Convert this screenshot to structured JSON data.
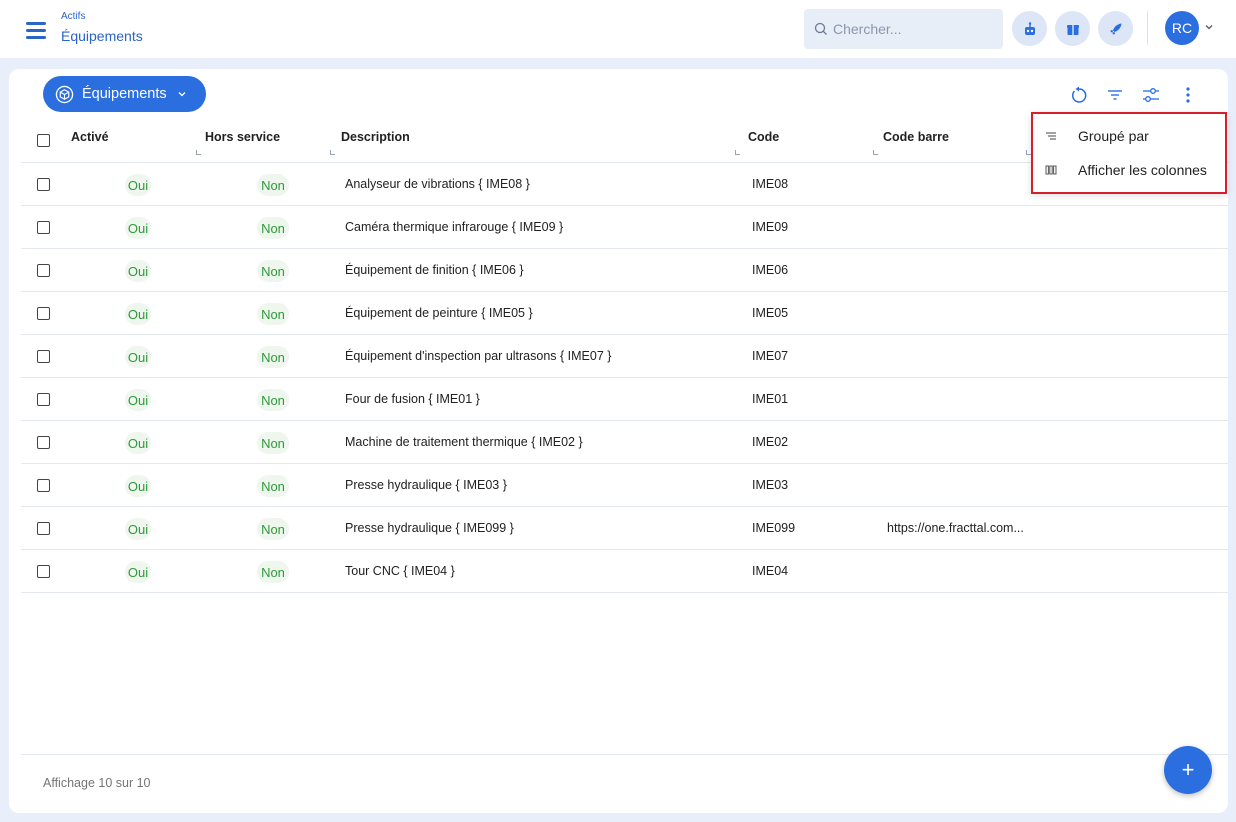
{
  "header": {
    "breadcrumb_parent": "Actifs",
    "title": "Équipements",
    "search_placeholder": "Chercher...",
    "avatar_initials": "RC"
  },
  "toolbar": {
    "view_selector_label": "Équipements"
  },
  "menu": {
    "items": [
      {
        "label": "Groupé par",
        "icon": "group-by-icon"
      },
      {
        "label": "Afficher les colonnes",
        "icon": "columns-icon"
      }
    ]
  },
  "table": {
    "columns": [
      "Activé",
      "Hors service",
      "Description",
      "Code",
      "Code barre"
    ],
    "rows": [
      {
        "active": "Oui",
        "out_of_service": "Non",
        "description": "Analyseur de vibrations { IME08 }",
        "code": "IME08",
        "barcode": ""
      },
      {
        "active": "Oui",
        "out_of_service": "Non",
        "description": "Caméra thermique infrarouge { IME09 }",
        "code": "IME09",
        "barcode": ""
      },
      {
        "active": "Oui",
        "out_of_service": "Non",
        "description": "Équipement de finition { IME06 }",
        "code": "IME06",
        "barcode": ""
      },
      {
        "active": "Oui",
        "out_of_service": "Non",
        "description": "Équipement de peinture { IME05 }",
        "code": "IME05",
        "barcode": ""
      },
      {
        "active": "Oui",
        "out_of_service": "Non",
        "description": "Équipement d'inspection par ultrasons { IME07 }",
        "code": "IME07",
        "barcode": ""
      },
      {
        "active": "Oui",
        "out_of_service": "Non",
        "description": "Four de fusion { IME01 }",
        "code": "IME01",
        "barcode": ""
      },
      {
        "active": "Oui",
        "out_of_service": "Non",
        "description": "Machine de traitement thermique { IME02 }",
        "code": "IME02",
        "barcode": ""
      },
      {
        "active": "Oui",
        "out_of_service": "Non",
        "description": "Presse hydraulique { IME03 }",
        "code": "IME03",
        "barcode": ""
      },
      {
        "active": "Oui",
        "out_of_service": "Non",
        "description": "Presse hydraulique { IME099 }",
        "code": "IME099",
        "barcode": "https://one.fracttal.com..."
      },
      {
        "active": "Oui",
        "out_of_service": "Non",
        "description": "Tour CNC { IME04 }",
        "code": "IME04",
        "barcode": ""
      }
    ]
  },
  "footer": {
    "pagination_text": "Affichage 10 sur 10",
    "fab_label": "+"
  },
  "colors": {
    "primary": "#2a6ee0",
    "status_green": "#2e9a3a",
    "highlight_border": "#d71f2b"
  }
}
